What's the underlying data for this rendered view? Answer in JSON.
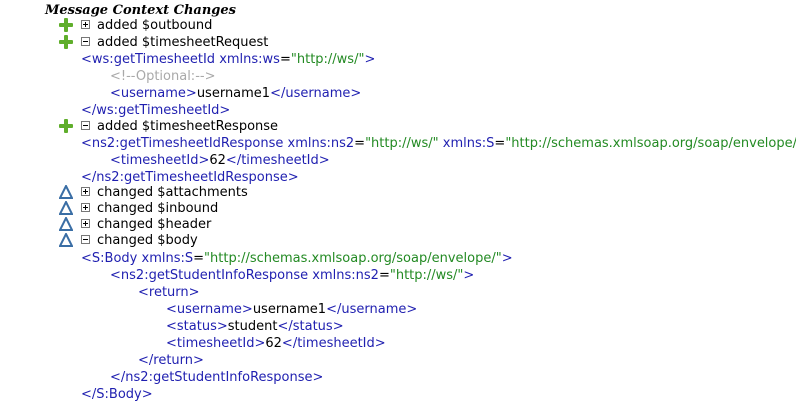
{
  "section_title": "Message Context Changes",
  "changes": [
    {
      "kind": "added",
      "label": "added $outbound",
      "expanded": false,
      "icon": "plus-icon"
    },
    {
      "kind": "added",
      "label": "added $timesheetRequest",
      "expanded": true,
      "icon": "plus-icon"
    },
    {
      "kind": "added",
      "label": "added $timesheetResponse",
      "expanded": true,
      "icon": "plus-icon"
    },
    {
      "kind": "changed",
      "label": "changed $attachments",
      "expanded": false,
      "icon": "delta-icon"
    },
    {
      "kind": "changed",
      "label": "changed $inbound",
      "expanded": false,
      "icon": "delta-icon"
    },
    {
      "kind": "changed",
      "label": "changed $header",
      "expanded": false,
      "icon": "delta-icon"
    },
    {
      "kind": "changed",
      "label": "changed $body",
      "expanded": true,
      "icon": "delta-icon"
    }
  ],
  "xml": {
    "req_open_tag": "ws:getTimesheetId",
    "req_ns_attr": "xmlns:ws",
    "req_ns_val": "\"http://ws/\"",
    "req_comment": "<!--Optional:-->",
    "username_tag": "username",
    "username_val": "username1",
    "resp_tag": "ns2:getTimesheetIdResponse",
    "resp_ns2_attr": "xmlns:ns2",
    "resp_ns2_val": "\"http://ws/\"",
    "s_attr": "xmlns:S",
    "s_val": "\"http://schemas.xmlsoap.org/soap/envelope/\"",
    "timesheet_tag": "timesheetId",
    "timesheet_val": "62",
    "body_tag": "S:Body",
    "student_tag": "ns2:getStudentInfoResponse",
    "return_tag": "return",
    "status_tag": "status",
    "status_val": "student"
  },
  "colors": {
    "tag": "#1f1fb0",
    "attr_value": "#238a23",
    "comment": "#a9a9a9",
    "added_icon": "#5fae2b",
    "changed_icon": "#3a6ea5"
  }
}
